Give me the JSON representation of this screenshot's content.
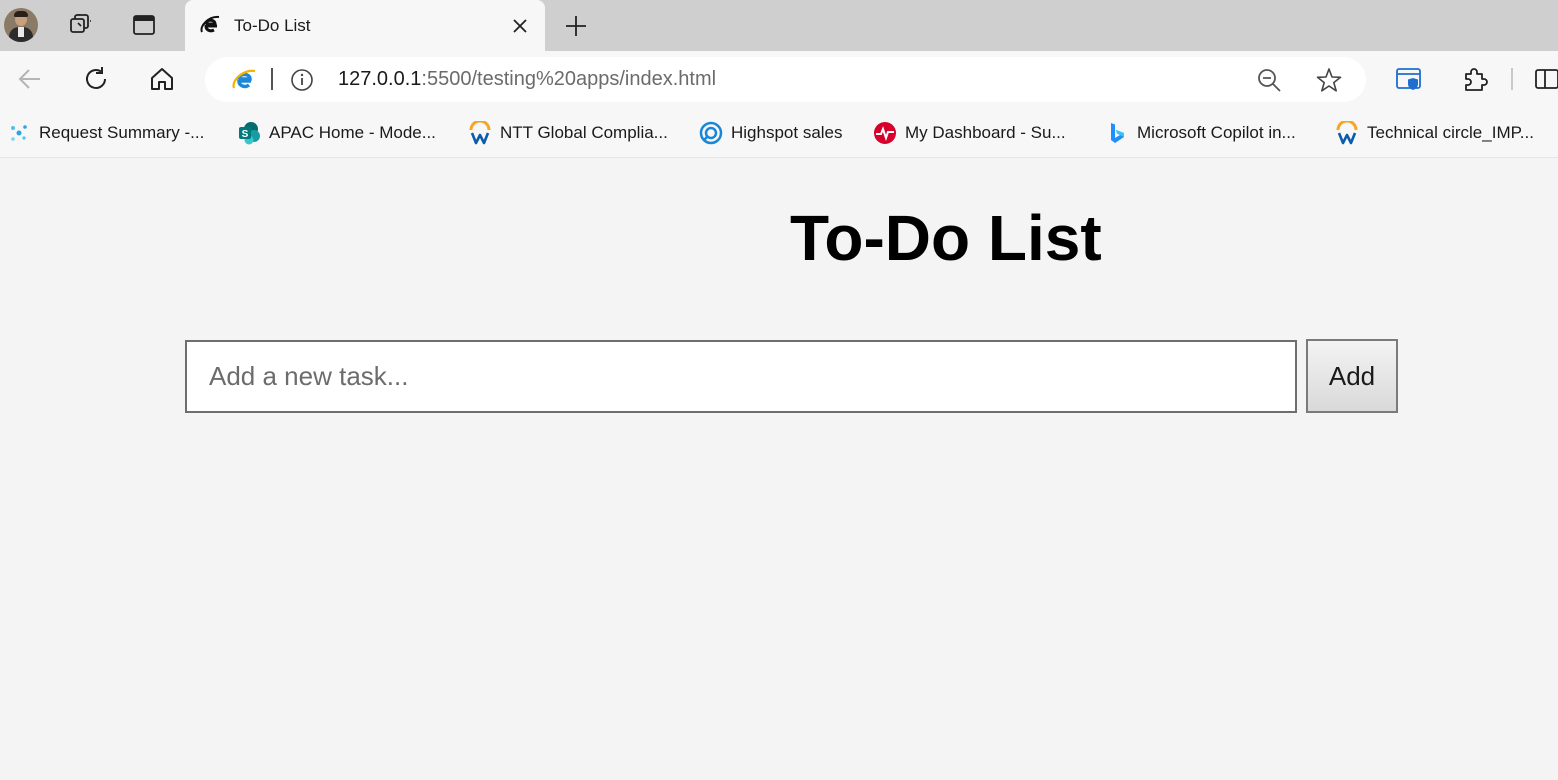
{
  "browser": {
    "tab": {
      "title": "To-Do List",
      "favicon": "ie-e-icon"
    },
    "icons": {
      "profile": "profile-avatar",
      "workspaces": "workspaces-icon",
      "tab_actions": "vertical-tabs-icon",
      "new_tab": "plus-icon",
      "back": "back-arrow-icon",
      "refresh": "refresh-icon",
      "home": "home-icon",
      "zoom": "zoom-out-icon",
      "favorite": "star-icon",
      "browser_essentials": "shield-icon",
      "extensions": "puzzle-icon",
      "split_screen": "split-screen-icon"
    },
    "address": {
      "host": "127.0.0.1",
      "rest": ":5500/testing%20apps/index.html"
    },
    "favorites": [
      {
        "label": "Request Summary -...",
        "icon": "request-summary-icon"
      },
      {
        "label": "APAC Home - Mode...",
        "icon": "sharepoint-icon"
      },
      {
        "label": "NTT Global Complia...",
        "icon": "workday-icon"
      },
      {
        "label": "Highspot sales",
        "icon": "highspot-icon"
      },
      {
        "label": "My Dashboard - Su...",
        "icon": "dashboard-icon"
      },
      {
        "label": "Microsoft Copilot in...",
        "icon": "bing-copilot-icon"
      },
      {
        "label": "Technical circle_IMP...",
        "icon": "workday-icon"
      }
    ]
  },
  "page": {
    "title": "To-Do List",
    "input": {
      "placeholder": "Add a new task...",
      "value": ""
    },
    "add_button": "Add"
  },
  "colors": {
    "tabstrip": "#cfcfcf",
    "toolbar": "#f7f7f7",
    "page_background": "#f4f4f4"
  }
}
